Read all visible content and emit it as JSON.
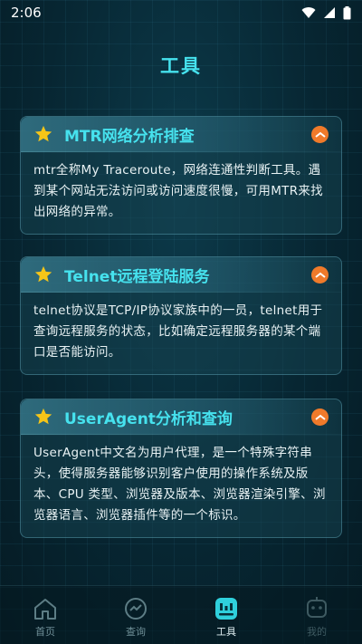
{
  "status_bar": {
    "time": "2:06"
  },
  "page": {
    "title": "工具"
  },
  "cards": [
    {
      "title": "MTR网络分析排查",
      "description": "mtr全称My  Traceroute，网络连通性判断工具。遇到某个网站无法访问或访问速度很慢，可用MTR来找出网络的异常。"
    },
    {
      "title": "Telnet远程登陆服务",
      "description": "telnet协议是TCP/IP协议家族中的一员，telnet用于查询远程服务的状态，比如确定远程服务器的某个端口是否能访问。"
    },
    {
      "title": "UserAgent分析和查询",
      "description": "UserAgent中文名为用户代理，是一个特殊字符串头，使得服务器能够识别客户使用的操作系统及版本、CPU 类型、浏览器及版本、浏览器渲染引擎、浏览器语言、浏览器插件等的一个标识。"
    }
  ],
  "bottom_nav": [
    {
      "label": "首页",
      "icon": "home-icon"
    },
    {
      "label": "查询",
      "icon": "query-icon"
    },
    {
      "label": "工具",
      "icon": "tools-icon",
      "active": true
    },
    {
      "label": "我的",
      "icon": "profile-icon"
    }
  ],
  "colors": {
    "accent": "#46e2ee",
    "star": "#f5c518",
    "toggle": "#f07a2a"
  }
}
